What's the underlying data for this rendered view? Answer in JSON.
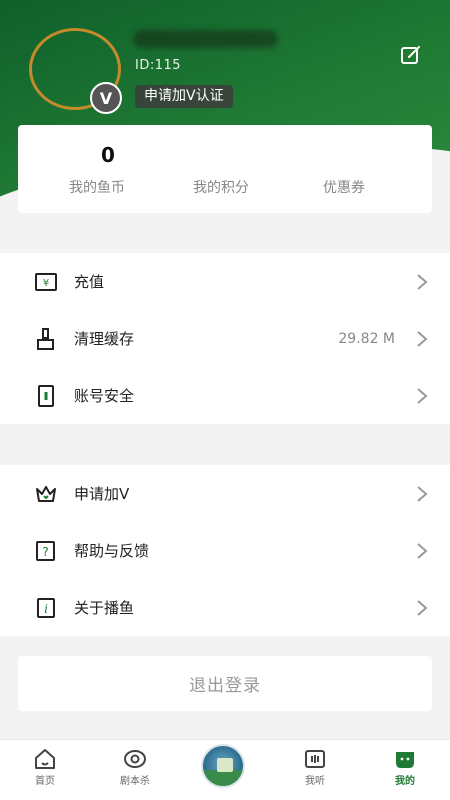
{
  "profile": {
    "uid": "ID:115",
    "verify_label": "申请加V认证",
    "badge_letter": "V"
  },
  "wallet": {
    "coin_count": "0",
    "items": [
      {
        "label": "我的鱼币"
      },
      {
        "label": "我的积分"
      },
      {
        "label": "优惠券"
      }
    ]
  },
  "menu": {
    "group1": [
      {
        "label": "充值",
        "icon": "recharge-icon",
        "value": ""
      },
      {
        "label": "清理缓存",
        "icon": "broom-icon",
        "value": "29.82 M"
      },
      {
        "label": "账号安全",
        "icon": "phone-lock-icon",
        "value": ""
      }
    ],
    "group2": [
      {
        "label": "申请加V",
        "icon": "crown-icon"
      },
      {
        "label": "帮助与反馈",
        "icon": "help-icon"
      },
      {
        "label": "关于播鱼",
        "icon": "info-icon"
      }
    ]
  },
  "logout_label": "退出登录",
  "tabbar": {
    "tabs": [
      {
        "label": "首页",
        "icon": "home-icon"
      },
      {
        "label": "剧本杀",
        "icon": "script-kill-icon"
      },
      {
        "label": "",
        "icon": "center-play-icon"
      },
      {
        "label": "我听",
        "icon": "listen-icon"
      },
      {
        "label": "我的",
        "icon": "mine-icon"
      }
    ],
    "active_index": 4
  },
  "colors": {
    "brand_green": "#1f7a34",
    "avatar_ring": "#c58a2a",
    "background": "#f3f3f3"
  }
}
